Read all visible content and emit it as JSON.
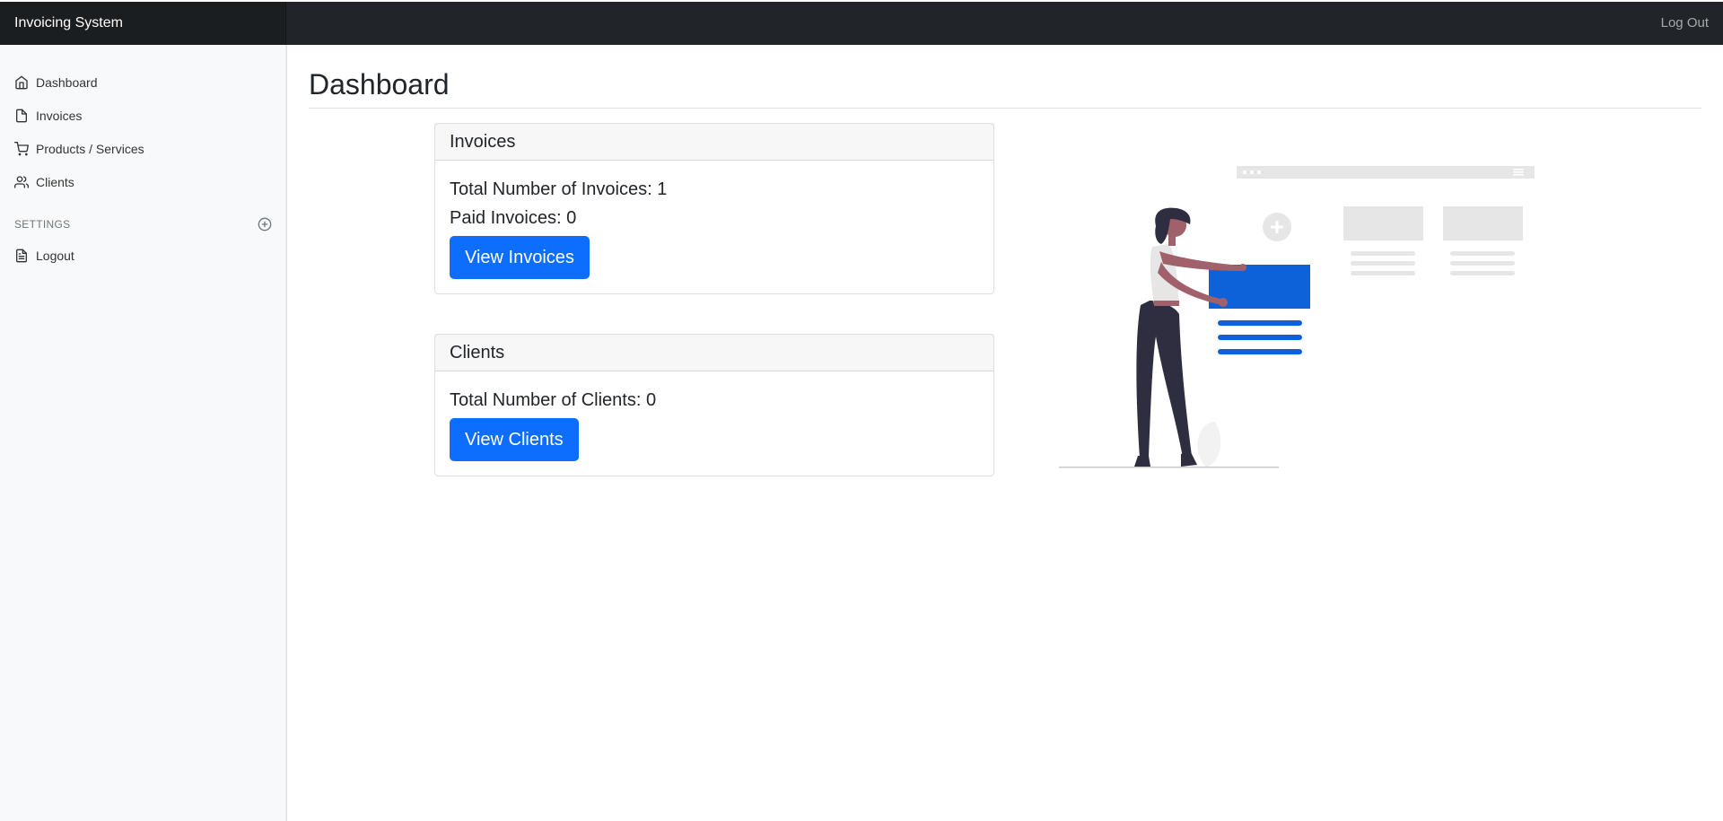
{
  "navbar": {
    "brand": "Invoicing System",
    "logout": "Log Out"
  },
  "sidebar": {
    "items": [
      {
        "label": "Dashboard",
        "icon": "home-icon"
      },
      {
        "label": "Invoices",
        "icon": "file-icon"
      },
      {
        "label": "Products / Services",
        "icon": "shopping-cart-icon"
      },
      {
        "label": "Clients",
        "icon": "users-icon"
      }
    ],
    "settings_heading": "SETTINGS",
    "settings_items": [
      {
        "label": "Logout",
        "icon": "file-text-icon"
      }
    ]
  },
  "main": {
    "title": "Dashboard",
    "invoices_card": {
      "header": "Invoices",
      "total": "Total Number of Invoices: 1",
      "paid": "Paid Invoices: 0",
      "button": "View Invoices"
    },
    "clients_card": {
      "header": "Clients",
      "total": "Total Number of Clients: 0",
      "button": "View Clients"
    }
  },
  "colors": {
    "navbar": "#212529",
    "primary": "#0d6efd",
    "illustration_accent": "#0d62d9",
    "sidebar_bg": "#f8f9fa"
  }
}
